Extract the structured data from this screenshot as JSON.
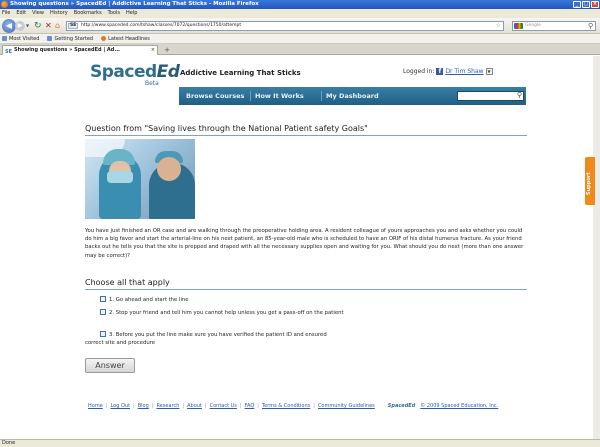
{
  "window": {
    "title": "Showing questions » SpacedEd | Addictive Learning That Sticks - Mozilla Firefox",
    "controls": {
      "minimize": "_",
      "maximize": "□",
      "close": "×"
    }
  },
  "menu": {
    "file": "File",
    "edit": "Edit",
    "view": "View",
    "history": "History",
    "bookmarks": "Bookmarks",
    "tools": "Tools",
    "help": "Help"
  },
  "nav": {
    "site_badge": "SE",
    "url": "http://www.spaceded.com/tshaw/classes/7072/questions/1750/attempt",
    "search_placeholder": "Google"
  },
  "bookmarks": {
    "most_visited": "Most Visited",
    "getting_started": "Getting Started",
    "latest_headlines": "Latest Headlines"
  },
  "tab": {
    "favicon": "SE",
    "label": "Showing questions » SpacedEd | Ad...",
    "close": "×",
    "new": "+"
  },
  "site": {
    "logo_main": "Spaced",
    "logo_ed": "Ed",
    "logo_sub": "Beta",
    "tagline": "Addictive Learning That Sticks",
    "login_prefix": "Logged in:",
    "fb": "f",
    "user": "Dr Tim Shaw",
    "user_drop": "▼",
    "nav": {
      "browse": "Browse Courses",
      "how": "How It Works",
      "dashboard": "My Dashboard"
    }
  },
  "question": {
    "title": "Question from \"Saving lives through the National Patient safety Goals\"",
    "text": "You have just finished an OR case and are walking through the preoperative holding area. A resident colleague of yours approaches you and asks whether you could do him a big favor and start the arterial-line on his next patient, an 85-year-old male who is scheduled to have an ORIF of his distal humerus fracture. As your friend backs out he tells you that the site is prepped and draped with all the necessary supplies open and waiting for you. What should you do next (more than one answer may be correct)?",
    "choose_label": "Choose all that apply",
    "options": [
      "1. Go ahead and start the line",
      "2. Stop your friend and tell him you cannot help unless you get a pass-off on the patient",
      "3. Before you put the line make sure you have verified the patient ID and ensured correct site and procedure"
    ],
    "answer_button": "Answer"
  },
  "footer": {
    "links": [
      "Home",
      "Log Out",
      "Blog",
      "Research",
      "About",
      "Contact Us",
      "FAQ",
      "Terms & Conditions",
      "Community Guidelines"
    ],
    "logo": "SpacedEd",
    "copyright": "© 2009 Spaced Education, Inc."
  },
  "support": {
    "label": "Support"
  },
  "status": {
    "text": "Done"
  }
}
